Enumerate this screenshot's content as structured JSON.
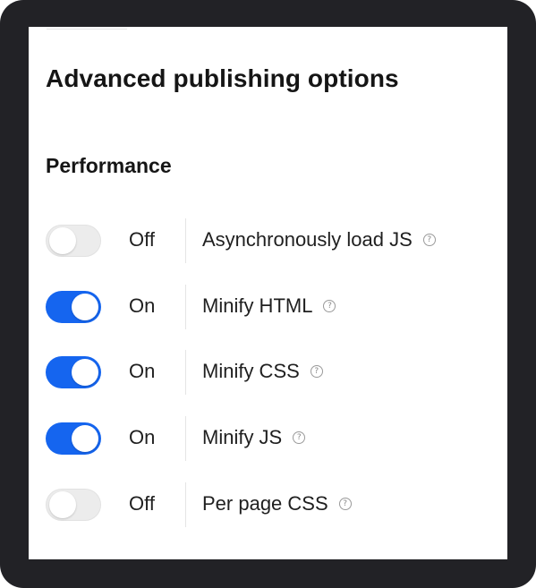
{
  "panel": {
    "title": "Advanced publishing options"
  },
  "section": {
    "title": "Performance",
    "options": [
      {
        "label": "Asynchronously load JS",
        "state": "Off",
        "enabled": false,
        "help_icon": "question-mark"
      },
      {
        "label": "Minify HTML",
        "state": "On",
        "enabled": true,
        "help_icon": "question-mark"
      },
      {
        "label": "Minify CSS",
        "state": "On",
        "enabled": true,
        "help_icon": "question-mark"
      },
      {
        "label": "Minify JS",
        "state": "On",
        "enabled": true,
        "help_icon": "question-mark"
      },
      {
        "label": "Per page CSS",
        "state": "Off",
        "enabled": false,
        "help_icon": "question-mark"
      }
    ]
  },
  "colors": {
    "toggle_on": "#1565ef",
    "toggle_off": "#ececec",
    "frame": "#222226"
  }
}
